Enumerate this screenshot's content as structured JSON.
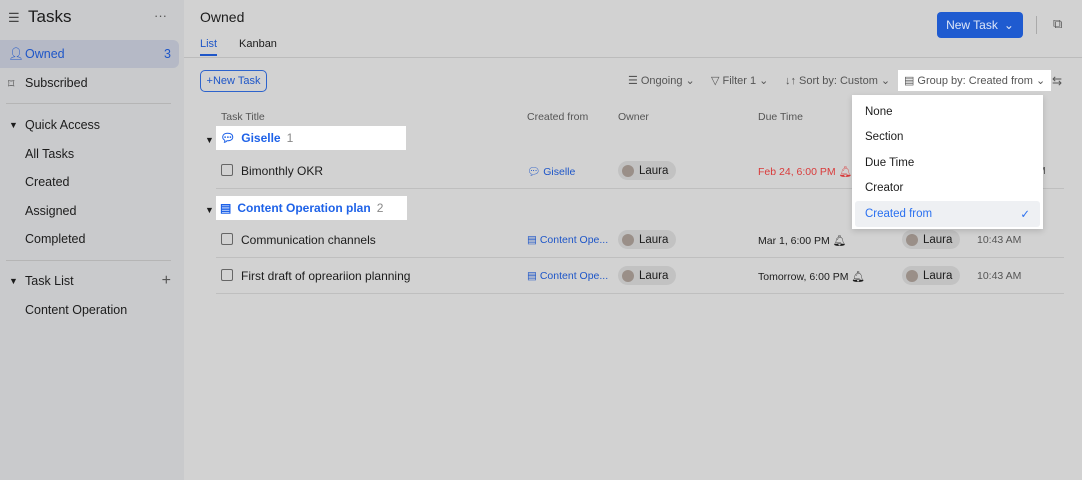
{
  "sidebar": {
    "title": "Tasks",
    "items": [
      {
        "label": "Owned",
        "count": "3"
      },
      {
        "label": "Subscribed"
      }
    ],
    "quick_access": {
      "label": "Quick Access",
      "items": [
        "All Tasks",
        "Created",
        "Assigned",
        "Completed"
      ]
    },
    "task_list": {
      "label": "Task List",
      "items": [
        "Content Operation"
      ]
    }
  },
  "header": {
    "title": "Owned",
    "tabs": [
      "List",
      "Kanban"
    ],
    "new_task": "New Task"
  },
  "toolbar": {
    "new_task": "New Task",
    "ongoing": "Ongoing",
    "filter": "Filter 1",
    "sort": "Sort by: Custom",
    "group": "Group by: Created from"
  },
  "columns": [
    "Task Title",
    "Created from",
    "Owner",
    "Due Time"
  ],
  "groups": [
    {
      "name": "Giselle",
      "count": "1",
      "tasks": [
        {
          "title": "Bimonthly OKR",
          "from": "Giselle",
          "owner": "Laura",
          "due": "Feb 24, 6:00 PM",
          "overdue": true,
          "creator": "",
          "time": "M"
        }
      ]
    },
    {
      "name": "Content Operation plan",
      "count": "2",
      "tasks": [
        {
          "title": "Communication channels",
          "from": "Content Ope...",
          "owner": "Laura",
          "due": "Mar 1, 6:00 PM",
          "creator": "Laura",
          "time": "10:43 AM"
        },
        {
          "title": "First draft of opreariion planning",
          "from": "Content Ope...",
          "owner": "Laura",
          "due": "Tomorrow, 6:00 PM",
          "creator": "Laura",
          "time": "10:43 AM"
        }
      ]
    }
  ],
  "group_menu": {
    "options": [
      "None",
      "Section",
      "Due Time",
      "Creator",
      "Created from"
    ],
    "selected": "Created from"
  },
  "colors": {
    "accent": "#1e62e8",
    "overdue": "#d93a3a"
  }
}
